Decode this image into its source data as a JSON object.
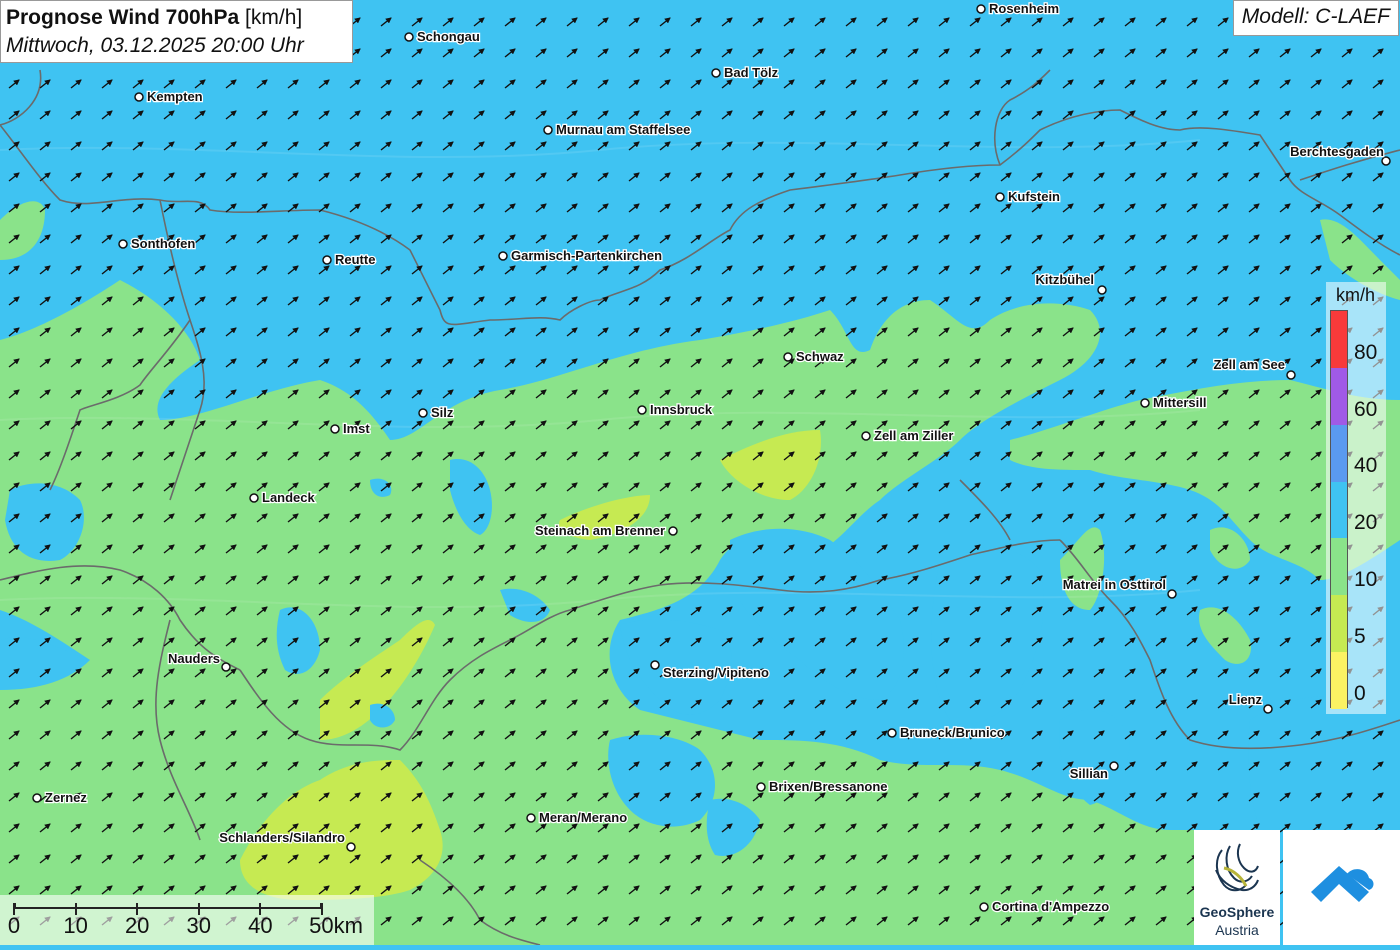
{
  "header": {
    "title_bold": "Prognose Wind 700hPa",
    "title_unit": "[km/h]",
    "subtitle": "Mittwoch, 03.12.2025 20:00 Uhr"
  },
  "model_label": "Modell: C-LAEF",
  "legend": {
    "unit": "km/h",
    "labels": [
      "80",
      "60",
      "40",
      "20",
      "10",
      "5",
      "0"
    ],
    "colors": [
      "#f83a3a",
      "#a05ae6",
      "#5a9af0",
      "#3fc3f2",
      "#8ae38a",
      "#c6ea52",
      "#fbf263"
    ]
  },
  "scale_bar": {
    "labels": [
      "0",
      "10",
      "20",
      "30",
      "40",
      "50km"
    ]
  },
  "logo": {
    "name": "GeoSphere",
    "country": "Austria"
  },
  "wind": {
    "direction": "south-west to north-east"
  },
  "cities": [
    {
      "name": "Rosenheim"
    },
    {
      "name": "Schongau"
    },
    {
      "name": "Bad Tölz"
    },
    {
      "name": "Kempten"
    },
    {
      "name": "Murnau am Staffelsee"
    },
    {
      "name": "Berchtesgaden"
    },
    {
      "name": "Kufstein"
    },
    {
      "name": "Sonthofen"
    },
    {
      "name": "Reutte"
    },
    {
      "name": "Garmisch-Partenkirchen"
    },
    {
      "name": "Kitzbühel"
    },
    {
      "name": "Schwaz"
    },
    {
      "name": "Zell am See"
    },
    {
      "name": "Mittersill"
    },
    {
      "name": "Innsbruck"
    },
    {
      "name": "Silz"
    },
    {
      "name": "Imst"
    },
    {
      "name": "Zell am Ziller"
    },
    {
      "name": "Landeck"
    },
    {
      "name": "Steinach am Brenner"
    },
    {
      "name": "Matrei in Osttirol"
    },
    {
      "name": "Nauders"
    },
    {
      "name": "Sterzing/Vipiteno"
    },
    {
      "name": "Lienz"
    },
    {
      "name": "Bruneck/Brunico"
    },
    {
      "name": "Sillian"
    },
    {
      "name": "Brixen/Bressanone"
    },
    {
      "name": "Zernez"
    },
    {
      "name": "Meran/Merano"
    },
    {
      "name": "Schlanders/Silandro"
    },
    {
      "name": "Cortina d'Ampezzo"
    }
  ]
}
